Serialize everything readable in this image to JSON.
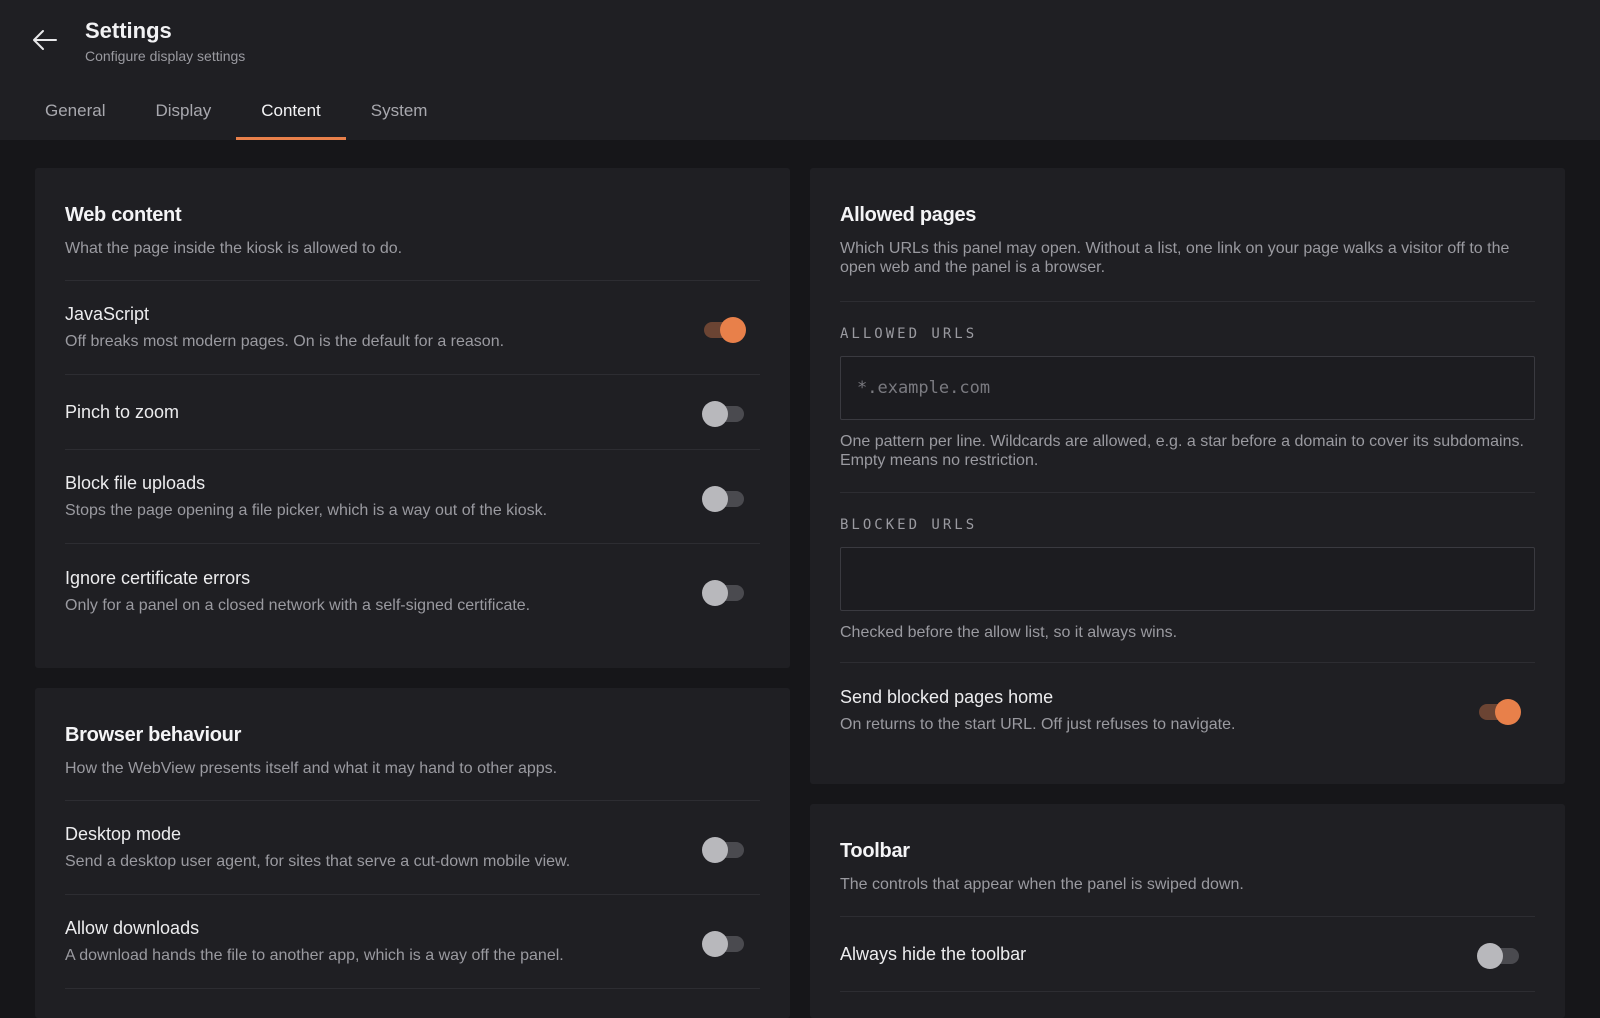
{
  "header": {
    "title": "Settings",
    "subtitle": "Configure display settings",
    "back_icon": "arrow-left-icon"
  },
  "tabs": [
    {
      "label": "General",
      "active": false
    },
    {
      "label": "Display",
      "active": false
    },
    {
      "label": "Content",
      "active": true
    },
    {
      "label": "System",
      "active": false
    }
  ],
  "accent_color": "#e8804a",
  "web_content": {
    "title": "Web content",
    "description": "What the page inside the kiosk is allowed to do.",
    "rows": [
      {
        "label": "JavaScript",
        "sub": "Off breaks most modern pages. On is the default for a reason.",
        "on": true
      },
      {
        "label": "Pinch to zoom",
        "sub": "",
        "on": false
      },
      {
        "label": "Block file uploads",
        "sub": "Stops the page opening a file picker, which is a way out of the kiosk.",
        "on": false
      },
      {
        "label": "Ignore certificate errors",
        "sub": "Only for a panel on a closed network with a self-signed certificate.",
        "on": false
      }
    ]
  },
  "browser_behaviour": {
    "title": "Browser behaviour",
    "description": "How the WebView presents itself and what it may hand to other apps.",
    "rows": [
      {
        "label": "Desktop mode",
        "sub": "Send a desktop user agent, for sites that serve a cut-down mobile view.",
        "on": false
      },
      {
        "label": "Allow downloads",
        "sub": "A download hands the file to another app, which is a way off the panel.",
        "on": false
      }
    ]
  },
  "allowed_pages": {
    "title": "Allowed pages",
    "description": "Which URLs this panel may open. Without a list, one link on your page walks a visitor off to the open web and the panel is a browser.",
    "allowed_label": "ALLOWED URLS",
    "allowed_value": "",
    "allowed_placeholder": "*.example.com",
    "allowed_help": "One pattern per line. Wildcards are allowed, e.g. a star before a domain to cover its subdomains. Empty means no restriction.",
    "blocked_label": "BLOCKED URLS",
    "blocked_value": "",
    "blocked_placeholder": "",
    "blocked_help": "Checked before the allow list, so it always wins.",
    "send_home": {
      "label": "Send blocked pages home",
      "sub": "On returns to the start URL. Off just refuses to navigate.",
      "on": true
    }
  },
  "toolbar": {
    "title": "Toolbar",
    "description": "The controls that appear when the panel is swiped down.",
    "rows": [
      {
        "label": "Always hide the toolbar",
        "sub": "",
        "on": false
      }
    ]
  }
}
